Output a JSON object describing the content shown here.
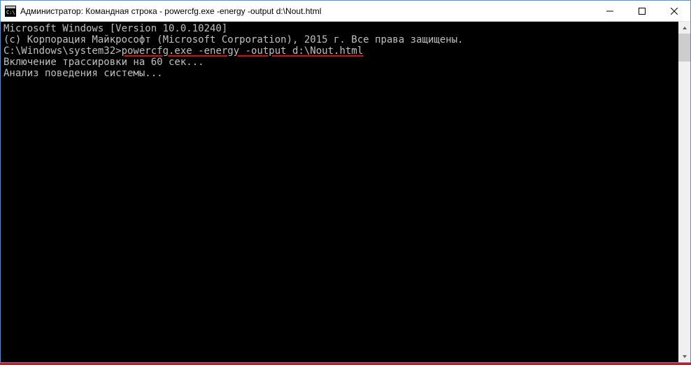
{
  "window": {
    "title": "Администратор: Командная строка - powercfg.exe  -energy -output d:\\Nout.html"
  },
  "terminal": {
    "line1": "Microsoft Windows [Version 10.0.10240]",
    "line2": "(с) Корпорация Майкрософт (Microsoft Corporation), 2015 г. Все права защищены.",
    "blank1": "",
    "prompt": "C:\\Windows\\system32>",
    "command": "powercfg.exe -energy -output d:\\Nout.html",
    "line4": "Включение трассировки на 60 сек...",
    "line5": "Анализ поведения системы..."
  }
}
